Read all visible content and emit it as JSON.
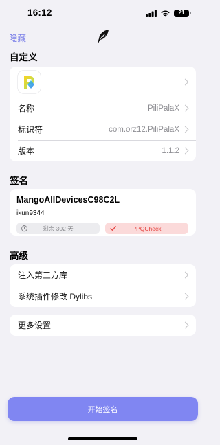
{
  "status_bar": {
    "time": "16:12",
    "battery": "21",
    "icons": [
      "cellular-signal-icon",
      "wifi-icon",
      "battery-icon"
    ]
  },
  "nav": {
    "hide_label": "隐藏",
    "logo_icon": "feather-logo-icon"
  },
  "custom_section": {
    "title": "自定义",
    "app_icon": "pilipala-app-icon",
    "rows": [
      {
        "label": "名称",
        "value": "PiliPalaX"
      },
      {
        "label": "标识符",
        "value": "com.orz12.PiliPalaX"
      },
      {
        "label": "版本",
        "value": "1.1.2"
      }
    ]
  },
  "signature_section": {
    "title": "签名",
    "certificate_name": "MangoAllDevicesC98C2L",
    "account": "ikun9344",
    "remaining": "剩余 302 天",
    "check_label": "PPQCheck"
  },
  "advanced_section": {
    "title": "高级",
    "rows": [
      {
        "label": "注入第三方库"
      },
      {
        "label": "系统插件修改 Dylibs"
      }
    ]
  },
  "more_settings": {
    "label": "更多设置"
  },
  "sign_button": {
    "label": "开始签名"
  },
  "colors": {
    "accent": "#7a7fe8",
    "button": "#8086f2",
    "background": "#f2f1f6",
    "danger": "#e4413e",
    "danger_bg": "#fbdada"
  }
}
